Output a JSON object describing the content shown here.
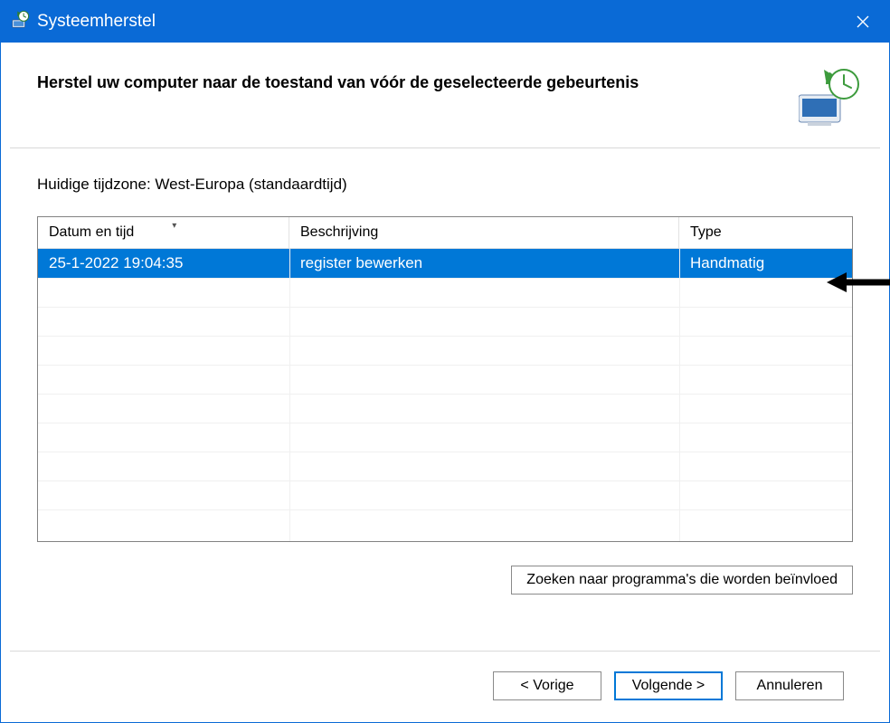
{
  "window": {
    "title": "Systeemherstel"
  },
  "header": {
    "heading": "Herstel uw computer naar de toestand van vóór de geselecteerde gebeurtenis"
  },
  "content": {
    "timezone_label": "Huidige tijdzone: West-Europa (standaardtijd)",
    "columns": {
      "date": "Datum en tijd",
      "desc": "Beschrijving",
      "type": "Type"
    },
    "rows": [
      {
        "date": "25-1-2022 19:04:35",
        "desc": "register bewerken",
        "type": "Handmatig",
        "selected": true
      }
    ],
    "scan_button": "Zoeken naar programma's die worden beïnvloed"
  },
  "footer": {
    "back": "< Vorige",
    "next": "Volgende >",
    "cancel": "Annuleren"
  }
}
